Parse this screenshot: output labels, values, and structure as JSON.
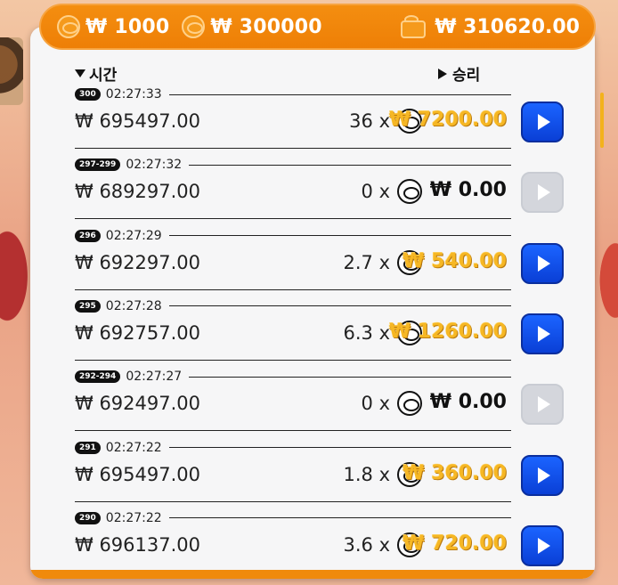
{
  "balance": {
    "coin_value": "₩ 1000",
    "total_bet": "₩ 300000",
    "wallet": "₩ 310620.00"
  },
  "headers": {
    "time": "시간",
    "win": "승리"
  },
  "colors": {
    "orange": "#f08a0c",
    "gold": "#f6b724",
    "blue": "#1b64ff",
    "disabled": "#d4d6dc"
  },
  "rows": [
    {
      "round": "300",
      "time": "02:27:33",
      "bet": "₩ 695497.00",
      "multiplier": "36 x",
      "win": "₩ 7200.00",
      "replay_enabled": true
    },
    {
      "round": "297-299",
      "time": "02:27:32",
      "bet": "₩ 689297.00",
      "multiplier": "0 x",
      "win": "₩ 0.00",
      "replay_enabled": false
    },
    {
      "round": "296",
      "time": "02:27:29",
      "bet": "₩ 692297.00",
      "multiplier": "2.7 x",
      "win": "₩ 540.00",
      "replay_enabled": true
    },
    {
      "round": "295",
      "time": "02:27:28",
      "bet": "₩ 692757.00",
      "multiplier": "6.3 x",
      "win": "₩ 1260.00",
      "replay_enabled": true
    },
    {
      "round": "292-294",
      "time": "02:27:27",
      "bet": "₩ 692497.00",
      "multiplier": "0 x",
      "win": "₩ 0.00",
      "replay_enabled": false
    },
    {
      "round": "291",
      "time": "02:27:22",
      "bet": "₩ 695497.00",
      "multiplier": "1.8 x",
      "win": "₩ 360.00",
      "replay_enabled": true
    },
    {
      "round": "290",
      "time": "02:27:22",
      "bet": "₩ 696137.00",
      "multiplier": "3.6 x",
      "win": "₩ 720.00",
      "replay_enabled": true
    }
  ]
}
